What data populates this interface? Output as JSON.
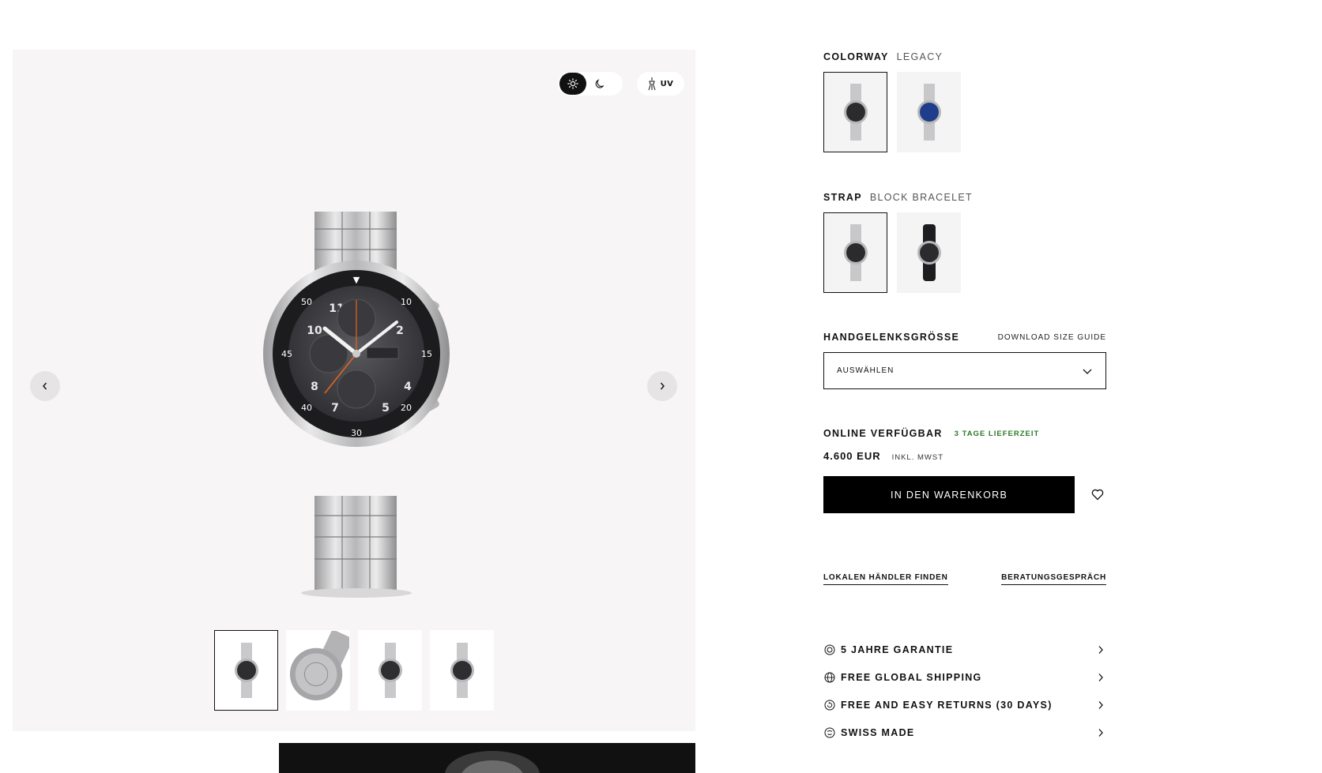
{
  "gallery": {
    "mode_uv_label": "UV",
    "thumbnails": [
      {
        "view": "front",
        "selected": true
      },
      {
        "view": "caseback",
        "selected": false
      },
      {
        "view": "angle",
        "selected": false
      },
      {
        "view": "side",
        "selected": false
      }
    ]
  },
  "colorway": {
    "title": "COLORWAY",
    "value": "LEGACY",
    "options": [
      {
        "dial": "#2b2b2e",
        "selected": true
      },
      {
        "dial": "#1f3d8a",
        "selected": false
      }
    ]
  },
  "strap": {
    "title": "STRAP",
    "value": "BLOCK BRACELET",
    "options": [
      {
        "band": "steel",
        "selected": true
      },
      {
        "band": "rubber",
        "selected": false
      }
    ]
  },
  "size": {
    "title": "HANDGELENKSGRÖSSE",
    "guide_link": "DOWNLOAD SIZE GUIDE",
    "select_value": "AUSWÄHLEN"
  },
  "availability": {
    "status": "ONLINE VERFÜGBAR",
    "delivery": "3 TAGE LIEFERZEIT",
    "delivery_color": "#2a7b2a"
  },
  "price": {
    "amount": "4.600 EUR",
    "tax_note": "INKL. MWST"
  },
  "cart": {
    "button_label": "IN DEN WARENKORB"
  },
  "links": {
    "dealer": "LOKALEN HÄNDLER FINDEN",
    "consult": "BERATUNGSGESPRÄCH"
  },
  "benefits": [
    {
      "label": "5 JAHRE GARANTIE",
      "icon": "warranty-icon"
    },
    {
      "label": "FREE GLOBAL SHIPPING",
      "icon": "globe-icon"
    },
    {
      "label": "FREE AND EASY RETURNS (30 DAYS)",
      "icon": "returns-icon"
    },
    {
      "label": "SWISS MADE",
      "icon": "swiss-icon"
    }
  ]
}
